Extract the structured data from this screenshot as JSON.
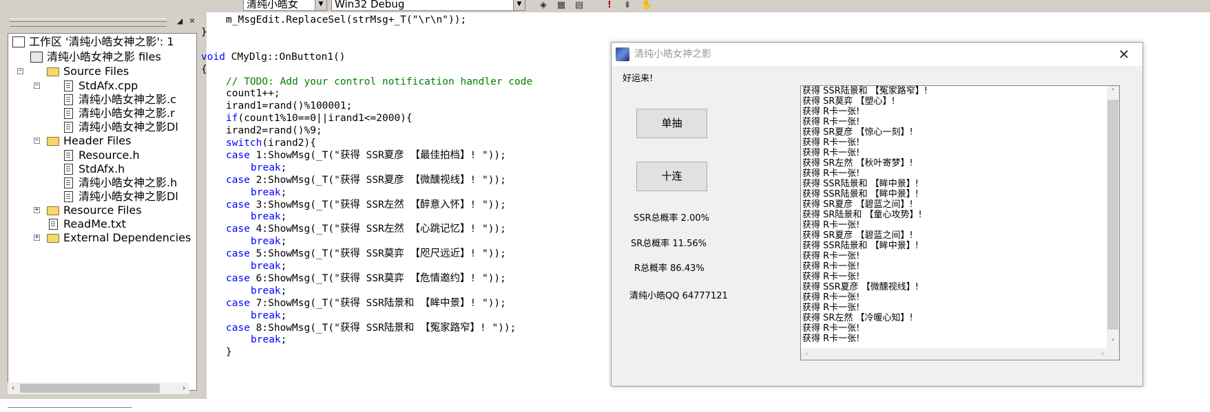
{
  "toolbar": {
    "project_combo": "清纯小皓女",
    "config_combo": "Win32 Debug",
    "icons": [
      "compile-icon",
      "build-icon",
      "stop-build-icon",
      "execute-icon",
      "step-icon",
      "hand-icon"
    ]
  },
  "workspace": {
    "items": [
      {
        "label": "工作区 '清纯小皓女神之影': 1",
        "type": "workspace"
      },
      {
        "label": "清纯小皓女神之影 files",
        "type": "project",
        "expander": "−"
      },
      {
        "label": "Source Files",
        "type": "folder",
        "expander": "−"
      },
      {
        "label": "StdAfx.cpp",
        "type": "file"
      },
      {
        "label": "清纯小皓女神之影.c",
        "type": "file"
      },
      {
        "label": "清纯小皓女神之影.r",
        "type": "file"
      },
      {
        "label": "清纯小皓女神之影Dl",
        "type": "file"
      },
      {
        "label": "Header Files",
        "type": "folder",
        "expander": "−"
      },
      {
        "label": "Resource.h",
        "type": "file"
      },
      {
        "label": "StdAfx.h",
        "type": "file"
      },
      {
        "label": "清纯小皓女神之影.h",
        "type": "file"
      },
      {
        "label": "清纯小皓女神之影Dl",
        "type": "file"
      },
      {
        "label": "Resource Files",
        "type": "folder",
        "expander": "+"
      },
      {
        "label": "ReadMe.txt",
        "type": "file"
      },
      {
        "label": "External Dependencies",
        "type": "folder",
        "expander": "+"
      }
    ]
  },
  "editor": {
    "lines": [
      {
        "indent": 1,
        "parts": [
          {
            "t": "m_MsgEdit.ReplaceSel(strMsg+_T(\"\\r\\n\"));",
            "c": "n"
          }
        ]
      },
      {
        "indent": 0,
        "parts": [
          {
            "t": "}",
            "c": "n"
          }
        ]
      },
      {
        "indent": 0,
        "parts": []
      },
      {
        "indent": 0,
        "parts": [
          {
            "t": "void",
            "c": "k"
          },
          {
            "t": " CMyDlg::OnButton1()",
            "c": "n"
          }
        ]
      },
      {
        "indent": 0,
        "parts": [
          {
            "t": "{",
            "c": "n"
          }
        ]
      },
      {
        "indent": 1,
        "parts": [
          {
            "t": "// TODO: Add your control notification handler code",
            "c": "c"
          }
        ]
      },
      {
        "indent": 1,
        "parts": [
          {
            "t": "count1++;",
            "c": "n"
          }
        ]
      },
      {
        "indent": 1,
        "parts": [
          {
            "t": "irand1=rand()%100001;",
            "c": "n"
          }
        ]
      },
      {
        "indent": 1,
        "parts": [
          {
            "t": "if",
            "c": "k"
          },
          {
            "t": "(count1%10==0||irand1<=2000){",
            "c": "n"
          }
        ]
      },
      {
        "indent": 1,
        "parts": [
          {
            "t": "irand2=rand()%9;",
            "c": "n"
          }
        ]
      },
      {
        "indent": 1,
        "parts": [
          {
            "t": "switch",
            "c": "k"
          },
          {
            "t": "(irand2){",
            "c": "n"
          }
        ]
      },
      {
        "indent": 1,
        "parts": [
          {
            "t": "case",
            "c": "k"
          },
          {
            "t": " 1:ShowMsg(_T(\"获得 SSR夏彦 【最佳拍档】! \"));",
            "c": "n"
          }
        ]
      },
      {
        "indent": 2,
        "parts": [
          {
            "t": "break",
            "c": "k"
          },
          {
            "t": ";",
            "c": "n"
          }
        ]
      },
      {
        "indent": 1,
        "parts": [
          {
            "t": "case",
            "c": "k"
          },
          {
            "t": " 2:ShowMsg(_T(\"获得 SSR夏彦 【微醺视线】! \"));",
            "c": "n"
          }
        ]
      },
      {
        "indent": 2,
        "parts": [
          {
            "t": "break",
            "c": "k"
          },
          {
            "t": ";",
            "c": "n"
          }
        ]
      },
      {
        "indent": 1,
        "parts": [
          {
            "t": "case",
            "c": "k"
          },
          {
            "t": " 3:ShowMsg(_T(\"获得 SSR左然 【醉意入怀】! \"));",
            "c": "n"
          }
        ]
      },
      {
        "indent": 2,
        "parts": [
          {
            "t": "break",
            "c": "k"
          },
          {
            "t": ";",
            "c": "n"
          }
        ]
      },
      {
        "indent": 1,
        "parts": [
          {
            "t": "case",
            "c": "k"
          },
          {
            "t": " 4:ShowMsg(_T(\"获得 SSR左然 【心跳记忆】! \"));",
            "c": "n"
          }
        ]
      },
      {
        "indent": 2,
        "parts": [
          {
            "t": "break",
            "c": "k"
          },
          {
            "t": ";",
            "c": "n"
          }
        ]
      },
      {
        "indent": 1,
        "parts": [
          {
            "t": "case",
            "c": "k"
          },
          {
            "t": " 5:ShowMsg(_T(\"获得 SSR莫弈 【咫尺远近】! \"));",
            "c": "n"
          }
        ]
      },
      {
        "indent": 2,
        "parts": [
          {
            "t": "break",
            "c": "k"
          },
          {
            "t": ";",
            "c": "n"
          }
        ]
      },
      {
        "indent": 1,
        "parts": [
          {
            "t": "case",
            "c": "k"
          },
          {
            "t": " 6:ShowMsg(_T(\"获得 SSR莫弈 【危情邀约】! \"));",
            "c": "n"
          }
        ]
      },
      {
        "indent": 2,
        "parts": [
          {
            "t": "break",
            "c": "k"
          },
          {
            "t": ";",
            "c": "n"
          }
        ]
      },
      {
        "indent": 1,
        "parts": [
          {
            "t": "case",
            "c": "k"
          },
          {
            "t": " 7:ShowMsg(_T(\"获得 SSR陆景和 【眸中景】! \"));",
            "c": "n"
          }
        ]
      },
      {
        "indent": 2,
        "parts": [
          {
            "t": "break",
            "c": "k"
          },
          {
            "t": ";",
            "c": "n"
          }
        ]
      },
      {
        "indent": 1,
        "parts": [
          {
            "t": "case",
            "c": "k"
          },
          {
            "t": " 8:ShowMsg(_T(\"获得 SSR陆景和 【冤家路窄】! \"));",
            "c": "n"
          }
        ]
      },
      {
        "indent": 2,
        "parts": [
          {
            "t": "break",
            "c": "k"
          },
          {
            "t": ";",
            "c": "n"
          }
        ]
      },
      {
        "indent": 1,
        "parts": [
          {
            "t": "}",
            "c": "n"
          }
        ]
      }
    ]
  },
  "dialog": {
    "title": "清纯小皓女神之影",
    "greeting": "好运来!",
    "single_button": "单抽",
    "ten_button": "十连",
    "ssr_rate": "SSR总概率 2.00%",
    "sr_rate": "SR总概率 11.56%",
    "r_rate": "R总概率 86.43%",
    "qq": "清纯小皓QQ 64777121",
    "log": [
      "获得 SSR陆景和 【冤家路窄】!",
      "获得 SR莫弈 【塑心】!",
      "获得 R卡一张!",
      "获得 R卡一张!",
      "获得 SR夏彦 【惊心一刻】!",
      "获得 R卡一张!",
      "获得 R卡一张!",
      "获得 SR左然 【秋叶寄梦】!",
      "获得 R卡一张!",
      "获得 SSR陆景和 【眸中景】!",
      "获得 SSR陆景和 【眸中景】!",
      "获得 SR夏彦 【碧蓝之间】!",
      "获得 SR陆景和 【童心攻势】!",
      "获得 R卡一张!",
      "获得 SR夏彦 【碧蓝之间】!",
      "获得 SSR陆景和 【眸中景】!",
      "获得 R卡一张!",
      "获得 R卡一张!",
      "获得 R卡一张!",
      "获得 SSR夏彦 【微醺视线】!",
      "获得 R卡一张!",
      "获得 R卡一张!",
      "获得 SR左然 【冷暖心知】!",
      "获得 R卡一张!",
      "获得 R卡一张!"
    ]
  }
}
